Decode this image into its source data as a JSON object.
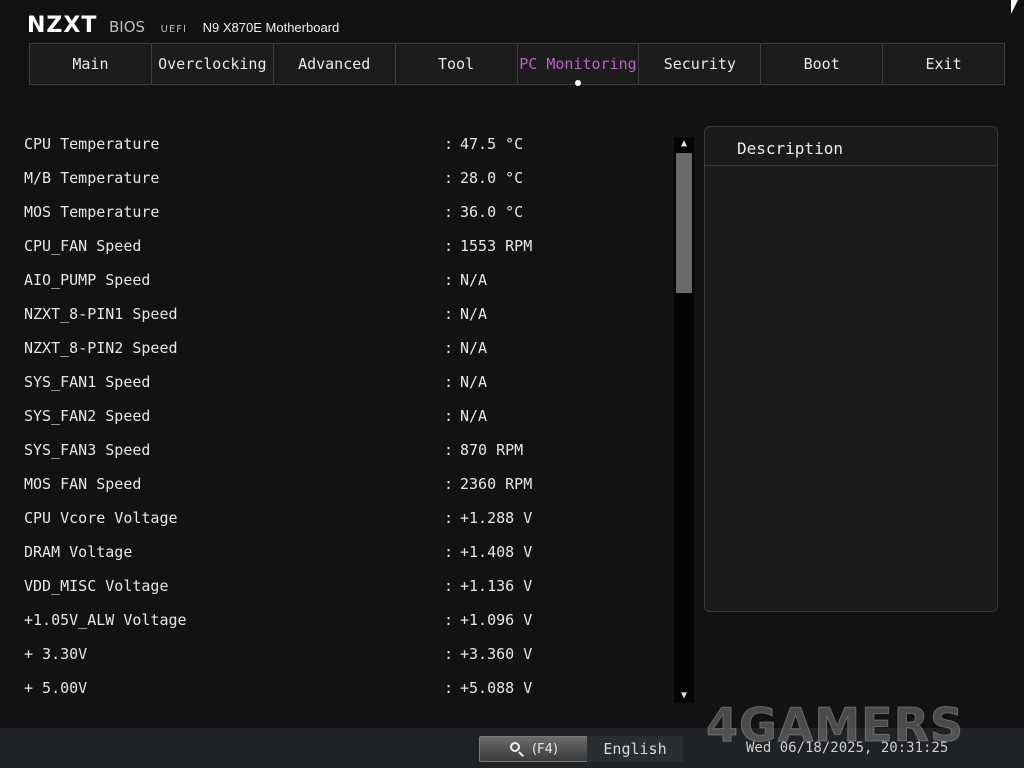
{
  "brand": {
    "logo": "NZXT",
    "bios": "BIOS",
    "uefi": "UEFI",
    "model": "N9 X870E Motherboard"
  },
  "tabs": [
    {
      "label": "Main"
    },
    {
      "label": "Overclocking"
    },
    {
      "label": "Advanced"
    },
    {
      "label": "Tool"
    },
    {
      "label": "PC Monitoring",
      "active": true
    },
    {
      "label": "Security"
    },
    {
      "label": "Boot"
    },
    {
      "label": "Exit"
    }
  ],
  "rows": [
    {
      "label": "CPU Temperature",
      "value": "47.5 °C"
    },
    {
      "label": "M/B Temperature",
      "value": "28.0 °C"
    },
    {
      "label": "MOS Temperature",
      "value": "36.0 °C"
    },
    {
      "label": "CPU_FAN Speed",
      "value": "1553 RPM"
    },
    {
      "label": "AIO_PUMP Speed",
      "value": "N/A"
    },
    {
      "label": "NZXT_8-PIN1 Speed",
      "value": "N/A"
    },
    {
      "label": "NZXT_8-PIN2 Speed",
      "value": "N/A"
    },
    {
      "label": "SYS_FAN1 Speed",
      "value": "N/A"
    },
    {
      "label": "SYS_FAN2 Speed",
      "value": "N/A"
    },
    {
      "label": "SYS_FAN3 Speed",
      "value": "870 RPM"
    },
    {
      "label": "MOS FAN Speed",
      "value": "2360 RPM"
    },
    {
      "label": "CPU Vcore Voltage",
      "value": "+1.288 V"
    },
    {
      "label": "DRAM Voltage",
      "value": "+1.408 V"
    },
    {
      "label": "VDD_MISC Voltage",
      "value": "+1.136 V"
    },
    {
      "label": "+1.05V_ALW Voltage",
      "value": "+1.096 V"
    },
    {
      "label": "+ 3.30V",
      "value": "+3.360 V"
    },
    {
      "label": "+ 5.00V",
      "value": "+5.088 V"
    }
  ],
  "separator": ":",
  "description": {
    "title": "Description"
  },
  "bottom": {
    "search_label": "(F4)",
    "language": "English",
    "datetime": "Wed 06/18/2025, 20:31:25"
  },
  "watermark": "4GAMERS",
  "icons": {
    "search": "magnifier-icon",
    "scroll_up": "triangle-up",
    "scroll_down": "triangle-down"
  },
  "colors": {
    "accent": "#c05ec8",
    "background": "#121212"
  }
}
